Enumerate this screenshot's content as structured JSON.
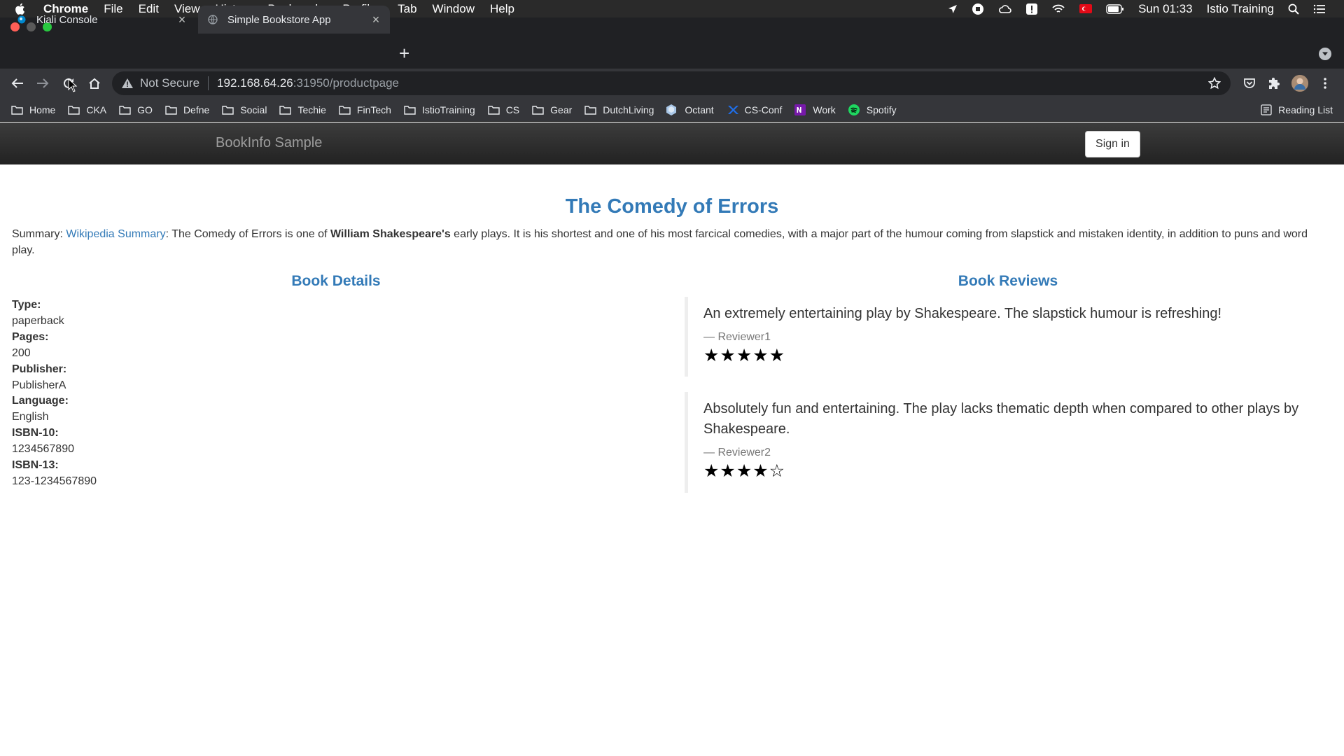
{
  "menubar": {
    "app": "Chrome",
    "items": [
      "File",
      "Edit",
      "View",
      "History",
      "Bookmarks",
      "Profiles",
      "Tab",
      "Window",
      "Help"
    ],
    "clock": "Sun 01:33",
    "user": "Istio Training"
  },
  "tabs": [
    {
      "title": "Kiali Console",
      "close": "×"
    },
    {
      "title": "Simple Bookstore App",
      "close": "×"
    }
  ],
  "newtab": "+",
  "address": {
    "security": "Not Secure",
    "host": "192.168.64.26",
    "path": ":31950/productpage"
  },
  "bookmarks": [
    {
      "label": "Home",
      "icon": "folder-icon"
    },
    {
      "label": "CKA",
      "icon": "folder-icon"
    },
    {
      "label": "GO",
      "icon": "folder-icon"
    },
    {
      "label": "Defne",
      "icon": "folder-icon"
    },
    {
      "label": "Social",
      "icon": "folder-icon"
    },
    {
      "label": "Techie",
      "icon": "folder-icon"
    },
    {
      "label": "FinTech",
      "icon": "folder-icon"
    },
    {
      "label": "IstioTraining",
      "icon": "folder-icon"
    },
    {
      "label": "CS",
      "icon": "folder-icon"
    },
    {
      "label": "Gear",
      "icon": "folder-icon"
    },
    {
      "label": "DutchLiving",
      "icon": "folder-icon"
    },
    {
      "label": "Octant",
      "icon": "octant-icon"
    },
    {
      "label": "CS-Conf",
      "icon": "cs-conf-icon"
    },
    {
      "label": "Work",
      "icon": "onenote-icon"
    },
    {
      "label": "Spotify",
      "icon": "spotify-icon"
    }
  ],
  "reading_list": "Reading List",
  "app": {
    "brand": "BookInfo Sample",
    "signin": "Sign in",
    "title": "The Comedy of Errors",
    "summary": {
      "prefix": "Summary: ",
      "link": "Wikipedia Summary",
      "text1": ": The Comedy of Errors is one of ",
      "bold": "William Shakespeare's",
      "text2": " early plays. It is his shortest and one of his most farcical comedies, with a major part of the humour coming from slapstick and mistaken identity, in addition to puns and word play."
    },
    "details_heading": "Book Details",
    "reviews_heading": "Book Reviews",
    "details": {
      "type_label": "Type:",
      "type": "paperback",
      "pages_label": "Pages:",
      "pages": "200",
      "publisher_label": "Publisher:",
      "publisher": "PublisherA",
      "language_label": "Language:",
      "language": "English",
      "isbn10_label": "ISBN-10:",
      "isbn10": "1234567890",
      "isbn13_label": "ISBN-13:",
      "isbn13": "123-1234567890"
    },
    "reviews": [
      {
        "text": "An extremely entertaining play by Shakespeare. The slapstick humour is refreshing!",
        "reviewer": "— Reviewer1",
        "stars": "★★★★★",
        "rating": 5
      },
      {
        "text": "Absolutely fun and entertaining. The play lacks thematic depth when compared to other plays by Shakespeare.",
        "reviewer": "— Reviewer2",
        "stars": "★★★★☆",
        "rating": 4
      }
    ]
  }
}
